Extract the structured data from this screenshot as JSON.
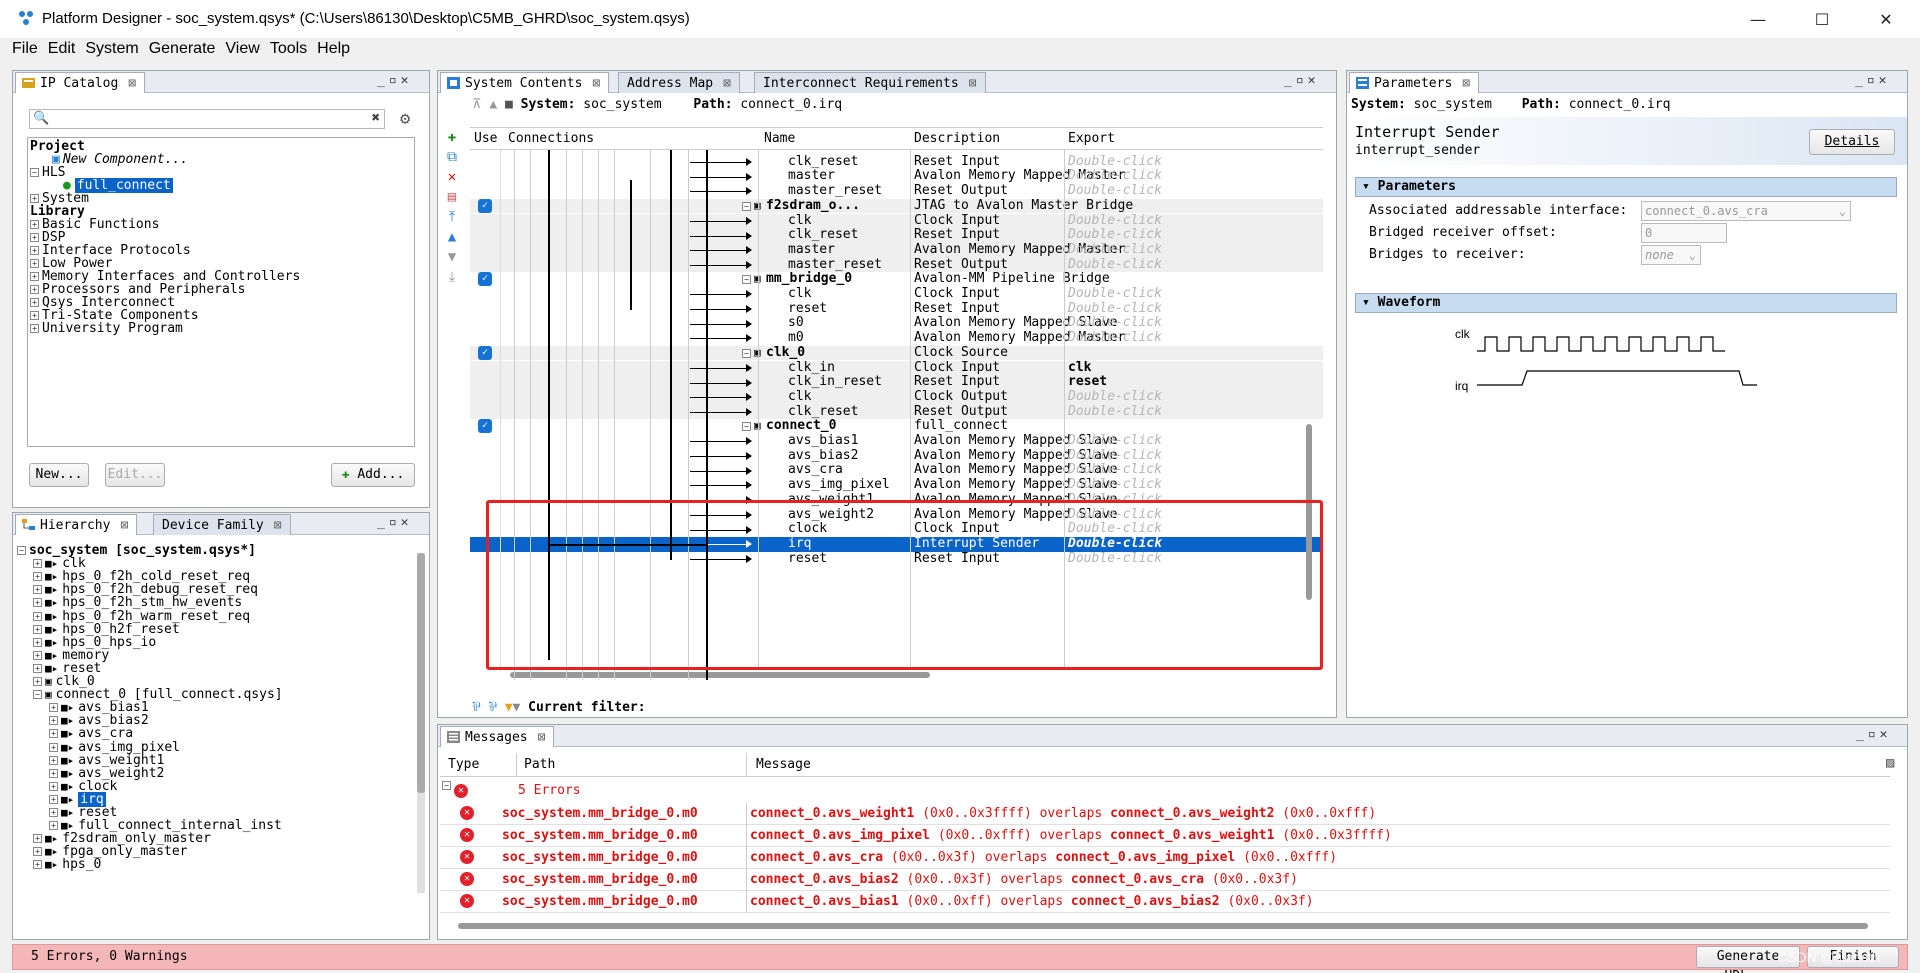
{
  "window": {
    "title": "Platform Designer - soc_system.qsys* (C:\\Users\\86130\\Desktop\\C5MB_GHRD\\soc_system.qsys)",
    "min": "—",
    "max": "☐",
    "close": "✕"
  },
  "menu": [
    "File",
    "Edit",
    "System",
    "Generate",
    "View",
    "Tools",
    "Help"
  ],
  "ipcatalog": {
    "tab": "IP Catalog",
    "search_placeholder": "",
    "tree": [
      {
        "label": "Project",
        "bold": true,
        "indent": 0,
        "exp": ""
      },
      {
        "label": "New Component...",
        "italic": true,
        "indent": 2,
        "exp": ""
      },
      {
        "label": "HLS",
        "indent": 0,
        "exp": "⊟"
      },
      {
        "label": "full_connect",
        "indent": 3,
        "exp": "",
        "selected": true
      },
      {
        "label": "System",
        "indent": 0,
        "exp": "⊞"
      },
      {
        "label": "Library",
        "bold": true,
        "indent": 0,
        "exp": ""
      },
      {
        "label": "Basic Functions",
        "indent": 0,
        "exp": "⊞"
      },
      {
        "label": "DSP",
        "indent": 0,
        "exp": "⊞"
      },
      {
        "label": "Interface Protocols",
        "indent": 0,
        "exp": "⊞"
      },
      {
        "label": "Low Power",
        "indent": 0,
        "exp": "⊞"
      },
      {
        "label": "Memory Interfaces and Controllers",
        "indent": 0,
        "exp": "⊞"
      },
      {
        "label": "Processors and Peripherals",
        "indent": 0,
        "exp": "⊞"
      },
      {
        "label": "Qsys Interconnect",
        "indent": 0,
        "exp": "⊞"
      },
      {
        "label": "Tri-State Components",
        "indent": 0,
        "exp": "⊞"
      },
      {
        "label": "University Program",
        "indent": 0,
        "exp": "⊞"
      }
    ],
    "new_btn": "New...",
    "edit_btn": "Edit...",
    "add_btn": "Add..."
  },
  "hierarchy": {
    "tabs": [
      "Hierarchy",
      "Device Family"
    ],
    "tree": [
      {
        "label": "soc_system [soc_system.qsys*]",
        "bold": true,
        "indent": 0
      },
      {
        "label": "clk",
        "indent": 1
      },
      {
        "label": "hps_0_f2h_cold_reset_req",
        "indent": 1
      },
      {
        "label": "hps_0_f2h_debug_reset_req",
        "indent": 1
      },
      {
        "label": "hps_0_f2h_stm_hw_events",
        "indent": 1
      },
      {
        "label": "hps_0_f2h_warm_reset_req",
        "indent": 1
      },
      {
        "label": "hps_0_h2f_reset",
        "indent": 1
      },
      {
        "label": "hps_0_hps_io",
        "indent": 1
      },
      {
        "label": "memory",
        "indent": 1
      },
      {
        "label": "reset",
        "indent": 1
      },
      {
        "label": "clk_0",
        "indent": 1
      },
      {
        "label": "connect_0 [full_connect.qsys]",
        "indent": 1
      },
      {
        "label": "avs_bias1",
        "indent": 2
      },
      {
        "label": "avs_bias2",
        "indent": 2
      },
      {
        "label": "avs_cra",
        "indent": 2
      },
      {
        "label": "avs_img_pixel",
        "indent": 2
      },
      {
        "label": "avs_weight1",
        "indent": 2
      },
      {
        "label": "avs_weight2",
        "indent": 2
      },
      {
        "label": "clock",
        "indent": 2
      },
      {
        "label": "irq",
        "indent": 2,
        "selected": true
      },
      {
        "label": "reset",
        "indent": 2
      },
      {
        "label": "full_connect_internal_inst",
        "indent": 2
      },
      {
        "label": "f2sdram_only_master",
        "indent": 1
      },
      {
        "label": "fpga_only_master",
        "indent": 1
      },
      {
        "label": "hps_0",
        "indent": 1
      }
    ]
  },
  "system": {
    "tabs": [
      "System Contents",
      "Address Map",
      "Interconnect Requirements"
    ],
    "system_label": "System:",
    "system_name": "soc_system",
    "path_label": "Path:",
    "path_value": "connect_0.irq",
    "headers": {
      "use": "Use",
      "connections": "Connections",
      "name": "Name",
      "description": "Description",
      "export": "Export"
    },
    "rows": [
      {
        "name": "clk",
        "desc": "Clock Input",
        "export": "Double-click",
        "indent": 2,
        "cut": true
      },
      {
        "name": "clk_reset",
        "desc": "Reset Input",
        "export": "Double-click",
        "indent": 2
      },
      {
        "name": "master",
        "desc": "Avalon Memory Mapped Master",
        "export": "Double-click",
        "indent": 2
      },
      {
        "name": "master_reset",
        "desc": "Reset Output",
        "export": "Double-click",
        "indent": 2
      },
      {
        "name": "f2sdram_o...",
        "desc": "JTAG to Avalon Master Bridge",
        "export": "",
        "indent": 0,
        "bold": true,
        "check": true,
        "grey": true
      },
      {
        "name": "clk",
        "desc": "Clock Input",
        "export": "Double-click",
        "indent": 2,
        "grey": true
      },
      {
        "name": "clk_reset",
        "desc": "Reset Input",
        "export": "Double-click",
        "indent": 2,
        "grey": true
      },
      {
        "name": "master",
        "desc": "Avalon Memory Mapped Master",
        "export": "Double-click",
        "indent": 2,
        "grey": true
      },
      {
        "name": "master_reset",
        "desc": "Reset Output",
        "export": "Double-click",
        "indent": 2,
        "grey": true
      },
      {
        "name": "mm_bridge_0",
        "desc": "Avalon-MM Pipeline Bridge",
        "export": "",
        "indent": 0,
        "bold": true,
        "check": true
      },
      {
        "name": "clk",
        "desc": "Clock Input",
        "export": "Double-click",
        "indent": 2
      },
      {
        "name": "reset",
        "desc": "Reset Input",
        "export": "Double-click",
        "indent": 2
      },
      {
        "name": "s0",
        "desc": "Avalon Memory Mapped Slave",
        "export": "Double-click",
        "indent": 2
      },
      {
        "name": "m0",
        "desc": "Avalon Memory Mapped Master",
        "export": "Double-click",
        "indent": 2
      },
      {
        "name": "clk_0",
        "desc": "Clock Source",
        "export": "",
        "indent": 0,
        "bold": true,
        "check": true,
        "grey": true
      },
      {
        "name": "clk_in",
        "desc": "Clock Input",
        "export": "clk",
        "indent": 2,
        "grey": true,
        "exbold": true
      },
      {
        "name": "clk_in_reset",
        "desc": "Reset Input",
        "export": "reset",
        "indent": 2,
        "grey": true,
        "exbold": true
      },
      {
        "name": "clk",
        "desc": "Clock Output",
        "export": "Double-click",
        "indent": 2,
        "grey": true
      },
      {
        "name": "clk_reset",
        "desc": "Reset Output",
        "export": "Double-click",
        "indent": 2,
        "grey": true
      },
      {
        "name": "connect_0",
        "desc": "full_connect",
        "export": "",
        "indent": 0,
        "bold": true,
        "check": true
      },
      {
        "name": "avs_bias1",
        "desc": "Avalon Memory Mapped Slave",
        "export": "Double-click",
        "indent": 2
      },
      {
        "name": "avs_bias2",
        "desc": "Avalon Memory Mapped Slave",
        "export": "Double-click",
        "indent": 2
      },
      {
        "name": "avs_cra",
        "desc": "Avalon Memory Mapped Slave",
        "export": "Double-click",
        "indent": 2
      },
      {
        "name": "avs_img_pixel",
        "desc": "Avalon Memory Mapped Slave",
        "export": "Double-click",
        "indent": 2
      },
      {
        "name": "avs_weight1",
        "desc": "Avalon Memory Mapped Slave",
        "export": "Double-click",
        "indent": 2
      },
      {
        "name": "avs_weight2",
        "desc": "Avalon Memory Mapped Slave",
        "export": "Double-click",
        "indent": 2
      },
      {
        "name": "clock",
        "desc": "Clock Input",
        "export": "Double-click",
        "indent": 2
      },
      {
        "name": "irq",
        "desc": "Interrupt Sender",
        "export": "Double-click",
        "indent": 2,
        "selected": true
      },
      {
        "name": "reset",
        "desc": "Reset Input",
        "export": "Double-click",
        "indent": 2
      }
    ],
    "filter_label": "Current filter:"
  },
  "parameters": {
    "tab": "Parameters",
    "system_label": "System:",
    "system_name": "soc_system",
    "path_label": "Path:",
    "path_value": "connect_0.irq",
    "comp_name": "Interrupt Sender",
    "comp_id": "interrupt_sender",
    "details_btn": "Details",
    "section1": "Parameters",
    "section2": "Waveform",
    "fields": [
      {
        "label": "Associated addressable interface:",
        "value": "connect_0.avs_cra"
      },
      {
        "label": "Bridged receiver offset:",
        "value": "0"
      },
      {
        "label": "Bridges to receiver:",
        "value": "none"
      }
    ],
    "wave": {
      "clk": "clk",
      "irq": "irq"
    }
  },
  "messages": {
    "tab": "Messages",
    "headers": {
      "type": "Type",
      "path": "Path",
      "message": "Message"
    },
    "summary": "5 Errors",
    "rows": [
      {
        "path": "soc_system.mm_bridge_0.m0",
        "a": "connect_0.avs_weight1",
        "ar": "(0x0..0x3ffff)",
        "ov": "overlaps",
        "b": "connect_0.avs_weight2",
        "br": "(0x0..0xfff)"
      },
      {
        "path": "soc_system.mm_bridge_0.m0",
        "a": "connect_0.avs_img_pixel",
        "ar": "(0x0..0xfff)",
        "ov": "overlaps",
        "b": "connect_0.avs_weight1",
        "br": "(0x0..0x3ffff)"
      },
      {
        "path": "soc_system.mm_bridge_0.m0",
        "a": "connect_0.avs_cra",
        "ar": "(0x0..0x3f)",
        "ov": "overlaps",
        "b": "connect_0.avs_img_pixel",
        "br": "(0x0..0xfff)"
      },
      {
        "path": "soc_system.mm_bridge_0.m0",
        "a": "connect_0.avs_bias2",
        "ar": "(0x0..0x3f)",
        "ov": "overlaps",
        "b": "connect_0.avs_cra",
        "br": "(0x0..0x3f)"
      },
      {
        "path": "soc_system.mm_bridge_0.m0",
        "a": "connect_0.avs_bias1",
        "ar": "(0x0..0xff)",
        "ov": "overlaps",
        "b": "connect_0.avs_bias2",
        "br": "(0x0..0x3f)"
      }
    ]
  },
  "status": {
    "text": "5 Errors, 0 Warnings",
    "generate": "Generate HDL...",
    "finish": "Finish",
    "watermark": "CSDN @starkith"
  },
  "colors": {
    "accent": "#0a63c9",
    "error": "#e0202a",
    "statusbar": "#f4b6b8",
    "highlight_box": "#e82020"
  }
}
